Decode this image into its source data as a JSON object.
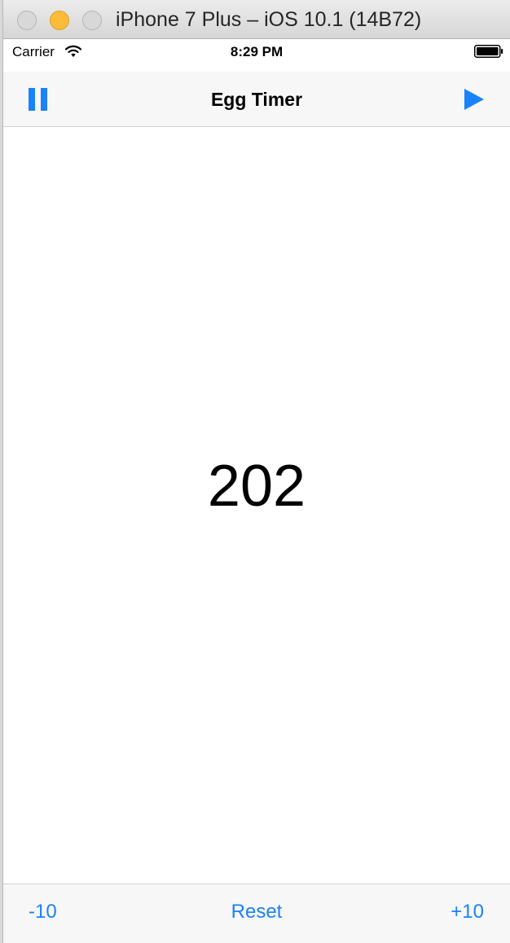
{
  "window": {
    "title": "iPhone 7 Plus – iOS 10.1 (14B72)"
  },
  "status_bar": {
    "carrier": "Carrier",
    "time": "8:29 PM",
    "icons": [
      "wifi-icon",
      "battery-icon"
    ]
  },
  "nav_bar": {
    "title": "Egg Timer",
    "left_button_icon": "pause-icon",
    "right_button_icon": "play-icon"
  },
  "main": {
    "timer_value": "202"
  },
  "toolbar": {
    "minus_label": "-10",
    "reset_label": "Reset",
    "plus_label": "+10"
  },
  "colors": {
    "accent": "#1a82fb",
    "nav_background": "#f7f7f7",
    "minimize_button": "#fcbc3a"
  }
}
